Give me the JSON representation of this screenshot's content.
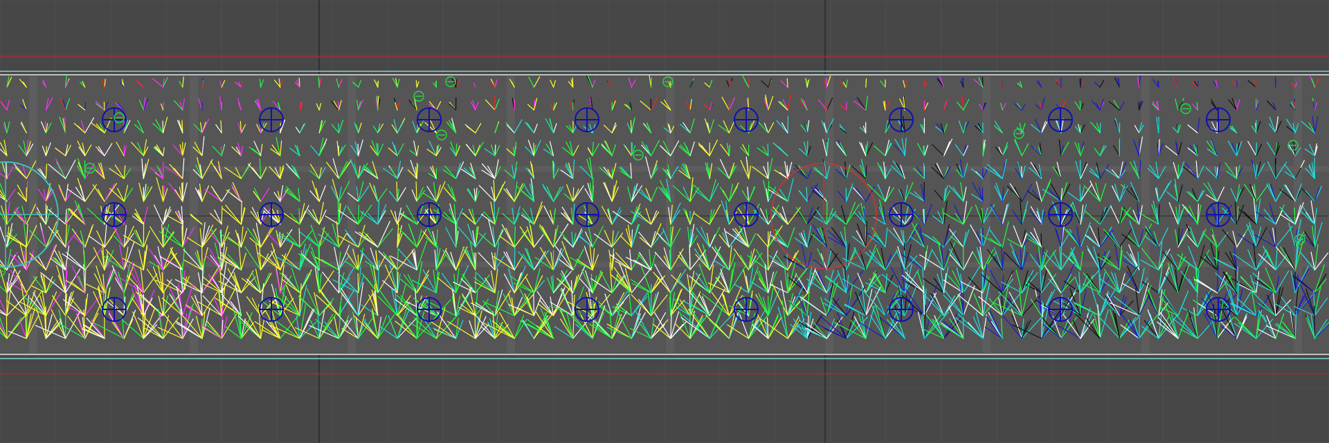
{
  "viewport": {
    "background": "#474747",
    "grid_color": "#4f4f4f",
    "axis_color": "#2a2a2a"
  },
  "corridor": {
    "floor_color": "#555555",
    "strip_color": "#5d5d5d",
    "border_teal": "#7fd8d0",
    "border_white": "#e8e8e8",
    "bound_red": "#c0262a"
  },
  "markers": {
    "blue_probe": {
      "icon": "crosshair-circle-icon",
      "color": "#1010b0"
    },
    "green_probe": {
      "icon": "minus-circle-icon",
      "color": "#20e040"
    },
    "teal_gizmo": {
      "icon": "large-circle-gizmo-icon",
      "color": "#40c0c0"
    },
    "red_gizmo": {
      "icon": "red-circle-gizmo-icon",
      "color": "#e03030"
    }
  },
  "vector_palette": [
    "#ffff30",
    "#20ff40",
    "#20e0e0",
    "#ffffff",
    "#ff30ff",
    "#ff2020",
    "#1a1ad0",
    "#101010"
  ]
}
